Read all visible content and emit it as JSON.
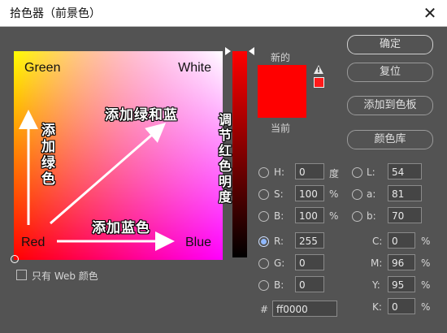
{
  "window": {
    "title": "拾色器（前景色）",
    "close": "✕"
  },
  "picker": {
    "corner_green": "Green",
    "corner_white": "White",
    "corner_red": "Red",
    "corner_blue": "Blue",
    "anno_add_green": "添加绿色",
    "anno_add_green_blue": "添加绿和蓝",
    "anno_add_blue": "添加蓝色",
    "anno_adjust_red": "调节红色明度"
  },
  "swatch": {
    "new_label": "新的",
    "current_label": "当前",
    "color": "#ff0000"
  },
  "buttons": {
    "ok": "确定",
    "reset": "复位",
    "add_to_swatches": "添加到色板",
    "color_libraries": "颜色库"
  },
  "hsb": {
    "h_label": "H:",
    "h_value": "0",
    "h_unit": "度",
    "s_label": "S:",
    "s_value": "100",
    "s_unit": "%",
    "b_label": "B:",
    "b_value": "100",
    "b_unit": "%"
  },
  "lab": {
    "l_label": "L:",
    "l_value": "54",
    "a_label": "a:",
    "a_value": "81",
    "b_label": "b:",
    "b_value": "70"
  },
  "rgb": {
    "r_label": "R:",
    "r_value": "255",
    "g_label": "G:",
    "g_value": "0",
    "b_label": "B:",
    "b_value": "0"
  },
  "cmyk": {
    "c_label": "C:",
    "c_value": "0",
    "c_unit": "%",
    "m_label": "M:",
    "m_value": "96",
    "m_unit": "%",
    "y_label": "Y:",
    "y_value": "95",
    "y_unit": "%",
    "k_label": "K:",
    "k_value": "0",
    "k_unit": "%"
  },
  "hex": {
    "label": "#",
    "value": "ff0000"
  },
  "web_only": {
    "label": "只有 Web 颜色"
  },
  "icons": {
    "warning": "warning-triangle-icon"
  }
}
